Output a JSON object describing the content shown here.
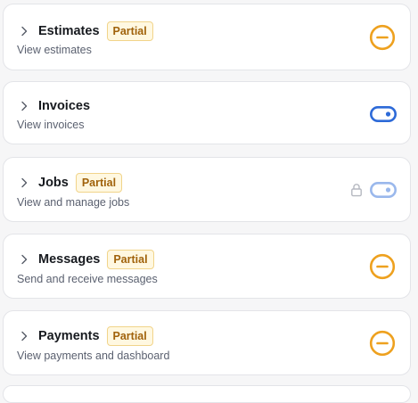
{
  "permissions": [
    {
      "title": "Estimates",
      "badge": "Partial",
      "description": "View estimates",
      "control": "partial-indicator",
      "locked": false
    },
    {
      "title": "Invoices",
      "badge": "",
      "description": "View invoices",
      "control": "toggle-on",
      "locked": false
    },
    {
      "title": "Jobs",
      "badge": "Partial",
      "description": "View and manage jobs",
      "control": "toggle-on-disabled",
      "locked": true
    },
    {
      "title": "Messages",
      "badge": "Partial",
      "description": "Send and receive messages",
      "control": "partial-indicator",
      "locked": false
    },
    {
      "title": "Payments",
      "badge": "Partial",
      "description": "View payments and dashboard",
      "control": "partial-indicator",
      "locked": false
    }
  ],
  "colors": {
    "partial_orange": "#eea11f",
    "toggle_blue": "#2d6ad8",
    "toggle_blue_disabled": "#9ab8ec",
    "lock_gray": "#b5b8c0",
    "badge_bg": "#fff8e1",
    "badge_text": "#a0620b"
  },
  "icons": {
    "expand": "chevron-right-icon",
    "partial": "minus-circle-icon",
    "toggle": "toggle-icon",
    "lock": "lock-icon"
  }
}
